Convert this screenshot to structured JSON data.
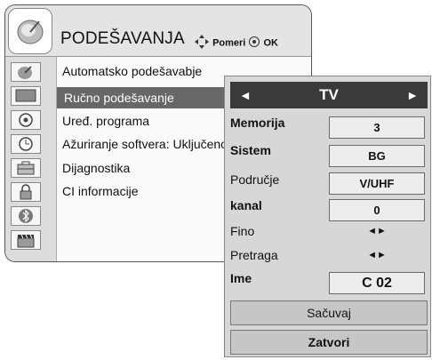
{
  "menu": {
    "title": "PODEŠAVANJA",
    "hint_move": "Pomeri",
    "hint_ok": "OK",
    "items": [
      {
        "label": "Automatsko podešavabje",
        "icon": "satellite-dish-icon"
      },
      {
        "label": "Ručno podešavanje",
        "icon": "monitor-icon",
        "selected": true
      },
      {
        "label": "Uređ. programa",
        "icon": "disc-icon"
      },
      {
        "label": "Ažuriranje softvera: Uključeno",
        "icon": "clock-icon"
      },
      {
        "label": "Dijagnostika",
        "icon": "toolbox-icon"
      },
      {
        "label": "CI informacije",
        "icon": "lock-icon"
      }
    ],
    "extra_icons": [
      "bluetooth-icon",
      "clapperboard-icon"
    ]
  },
  "panel": {
    "source": "TV",
    "rows": [
      {
        "label": "Memorija",
        "value": "3"
      },
      {
        "label": "Sistem",
        "value": "BG"
      },
      {
        "label": "Područje",
        "value": "V/UHF"
      },
      {
        "label": "kanal",
        "value": "0"
      },
      {
        "label": "Fino",
        "value": "◄►"
      },
      {
        "label": "Pretraga",
        "value": "◄►"
      },
      {
        "label": "Ime",
        "value": "C 02"
      }
    ],
    "save_label": "Sačuvaj",
    "close_label": "Zatvori"
  }
}
